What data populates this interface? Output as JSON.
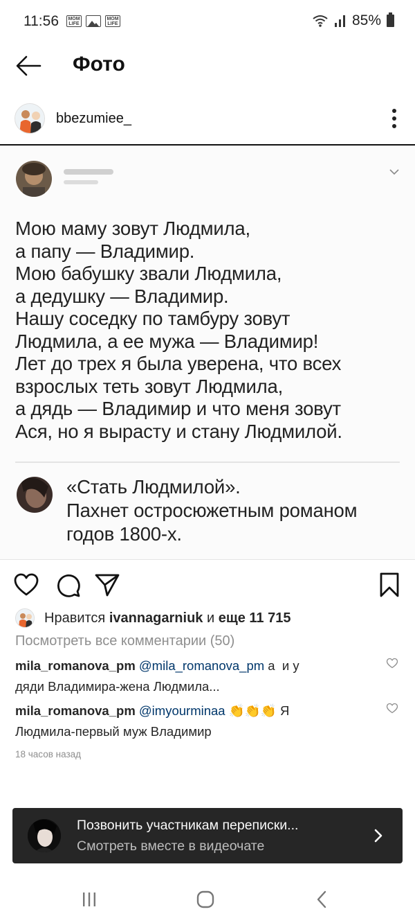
{
  "status_bar": {
    "time": "11:56",
    "left_icons": [
      "mom-life-icon",
      "image-icon",
      "mom-life-icon"
    ],
    "battery": "85%"
  },
  "header": {
    "title": "Фото",
    "back_icon": "arrow-left-icon"
  },
  "author": {
    "username": "bbezumiee_"
  },
  "post_image": {
    "tweet_lines": "Мою маму зовут Людмила,\nа папу — Владимир.\nМою бабушку звали Людмила,\nа дедушку — Владимир.\nНашу соседку по тамбуру зовут\nЛюдмила, а ее мужа — Владимир!\nЛет до трех я была уверена, что всех\nвзрослых теть зовут Людмила,\nа дядь — Владимир и что меня зовут\nАся, но я вырасту и стану Людмилой.",
    "reply_lines": "«Стать Людмилой».\nПахнет остросюжетным романом\nгодов 1800-х."
  },
  "likes": {
    "prefix": "Нравится ",
    "user": "ivannagarniuk",
    "middle": " и ",
    "more": "еще 11 715"
  },
  "view_comments": "Посмотреть все комментарии (50)",
  "comments": [
    {
      "user": "mila_romanova_pm",
      "mention": "@mila_romanova_pm",
      "text_line1": " а  и у",
      "text_line2": "дяди Владимира-жена Людмила..."
    },
    {
      "user": "mila_romanova_pm",
      "mention": "@imyourminaa",
      "emoji": "👏👏👏",
      "text_line1": " Я",
      "text_line2": "Людмила-первый муж Владимир"
    }
  ],
  "timestamp": "18 часов назад",
  "video_chat": {
    "title": "Позвонить участникам переписки...",
    "subtitle": "Смотреть вместе в видеочате"
  },
  "colors": {
    "banner_bg": "#262626",
    "mention": "#00376b",
    "muted": "#8e8e8e"
  }
}
